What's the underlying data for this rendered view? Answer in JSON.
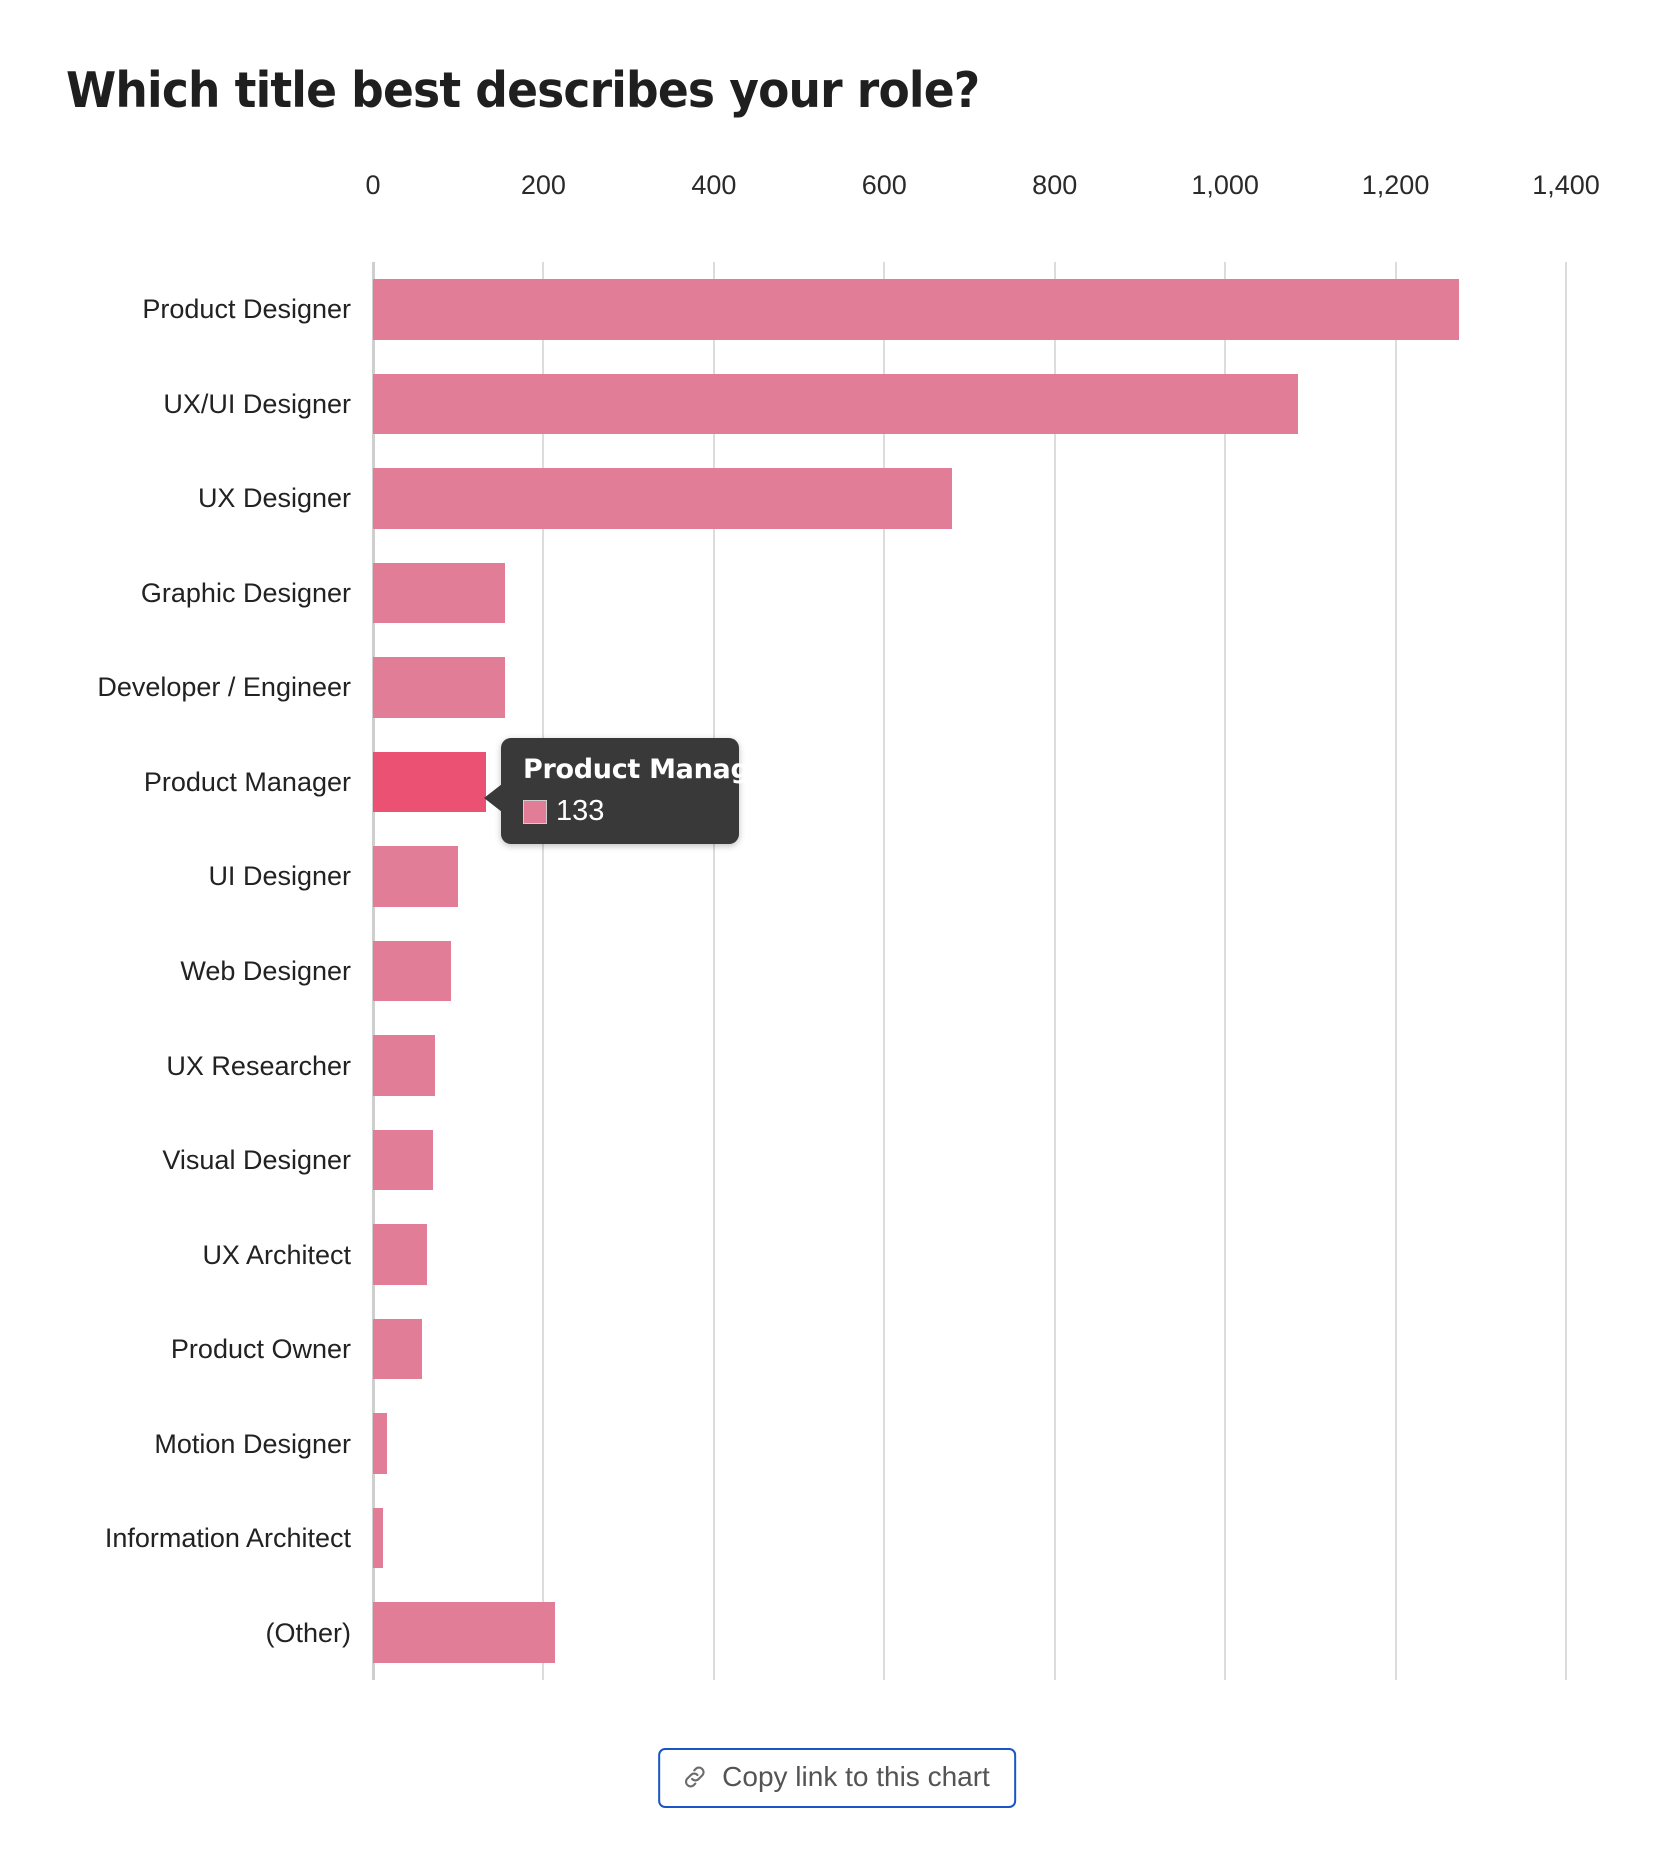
{
  "chart_data": {
    "type": "bar",
    "orientation": "horizontal",
    "title": "Which title best describes your role?",
    "xlabel": "",
    "ylabel": "",
    "xlim": [
      0,
      1400
    ],
    "xticks": [
      0,
      200,
      400,
      600,
      800,
      1000,
      1200,
      1400
    ],
    "xtick_labels": [
      "0",
      "200",
      "400",
      "600",
      "800",
      "1,000",
      "1,200",
      "1,400"
    ],
    "grid": "vertical",
    "legend": "none",
    "categories": [
      "Product Designer",
      "UX/UI Designer",
      "UX Designer",
      "Graphic Designer",
      "Developer / Engineer",
      "Product Manager",
      "UI Designer",
      "Web Designer",
      "UX Researcher",
      "Visual Designer",
      "UX Architect",
      "Product Owner",
      "Motion Designer",
      "Information Architect",
      "(Other)"
    ],
    "values": [
      1275,
      1085,
      680,
      155,
      155,
      133,
      100,
      92,
      73,
      70,
      63,
      57,
      17,
      12,
      213
    ],
    "highlighted_index": 5,
    "bar_color": "#e27d97",
    "highlight_color": "#eb5173",
    "gridline_color": "#dcdcdc"
  },
  "tooltip": {
    "title": "Product Manager",
    "value": "133",
    "swatch_color": "#e27d97",
    "background": "#393939"
  },
  "footer": {
    "copy_link_label": "Copy link to this chart",
    "icon": "link-icon",
    "border_color": "#1a56c4"
  }
}
